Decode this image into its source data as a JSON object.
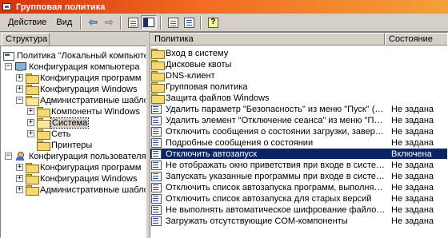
{
  "window": {
    "title": "Групповая политика"
  },
  "menu": {
    "action": "Действие",
    "view": "Вид"
  },
  "toolbar": {
    "icons": [
      "back-arrow-icon",
      "forward-arrow-icon",
      "show-hide-tree-icon",
      "properties-icon",
      "export-list-icon",
      "help-icon"
    ]
  },
  "left_panel": {
    "tab_label": "Структура"
  },
  "tree": {
    "root": "Политика \"Локальный компьютер\"",
    "computer_config": "Конфигурация компьютера",
    "cc_programs": "Конфигурация программ",
    "cc_windows": "Конфигурация Windows",
    "cc_admin": "Административные шаблоны",
    "cc_components": "Компоненты Windows",
    "cc_system": "Система",
    "cc_network": "Сеть",
    "cc_printers": "Принтеры",
    "user_config": "Конфигурация пользователя",
    "uc_programs": "Конфигурация программ",
    "uc_windows": "Конфигурация Windows",
    "uc_admin": "Административные шаблоны"
  },
  "list": {
    "col_policy": "Политика",
    "col_state": "Состояние",
    "folders": [
      "Вход в систему",
      "Дисковые квоты",
      "DNS-клиент",
      "Групповая политика",
      "Защита файлов Windows"
    ],
    "settings": [
      {
        "name": "Удалить параметр \"Безопасность\" из меню \"Пуск\" (только дл...",
        "state": "Не задана"
      },
      {
        "name": "Удалить элемент \"Отключение сеанса\" из меню \"Пуск\" (только ...",
        "state": "Не задана"
      },
      {
        "name": "Отключить сообщения о состоянии загрузки, завершения ра...",
        "state": "Не задана"
      },
      {
        "name": "Подробные сообщения о состоянии",
        "state": "Не задана"
      },
      {
        "name": "Отключить автозапуск",
        "state": "Включена"
      },
      {
        "name": "Не отображать окно приветствия при входе в систему",
        "state": "Не задана"
      },
      {
        "name": "Запускать указанные программы при входе в систему",
        "state": "Не задана"
      },
      {
        "name": "Отключить список автозапуска программ, выполняемых одн...",
        "state": "Не задана"
      },
      {
        "name": "Отключить список автозапуска для старых версий",
        "state": "Не задана"
      },
      {
        "name": "Не выполнять автоматическое шифрование файлов, переме...",
        "state": "Не задана"
      },
      {
        "name": "Загружать отсутствующие COM-компоненты",
        "state": "Не задана"
      }
    ]
  },
  "colors": {
    "title_start": "#d6330c",
    "title_end": "#f3a03a",
    "selection": "#0a246a"
  }
}
